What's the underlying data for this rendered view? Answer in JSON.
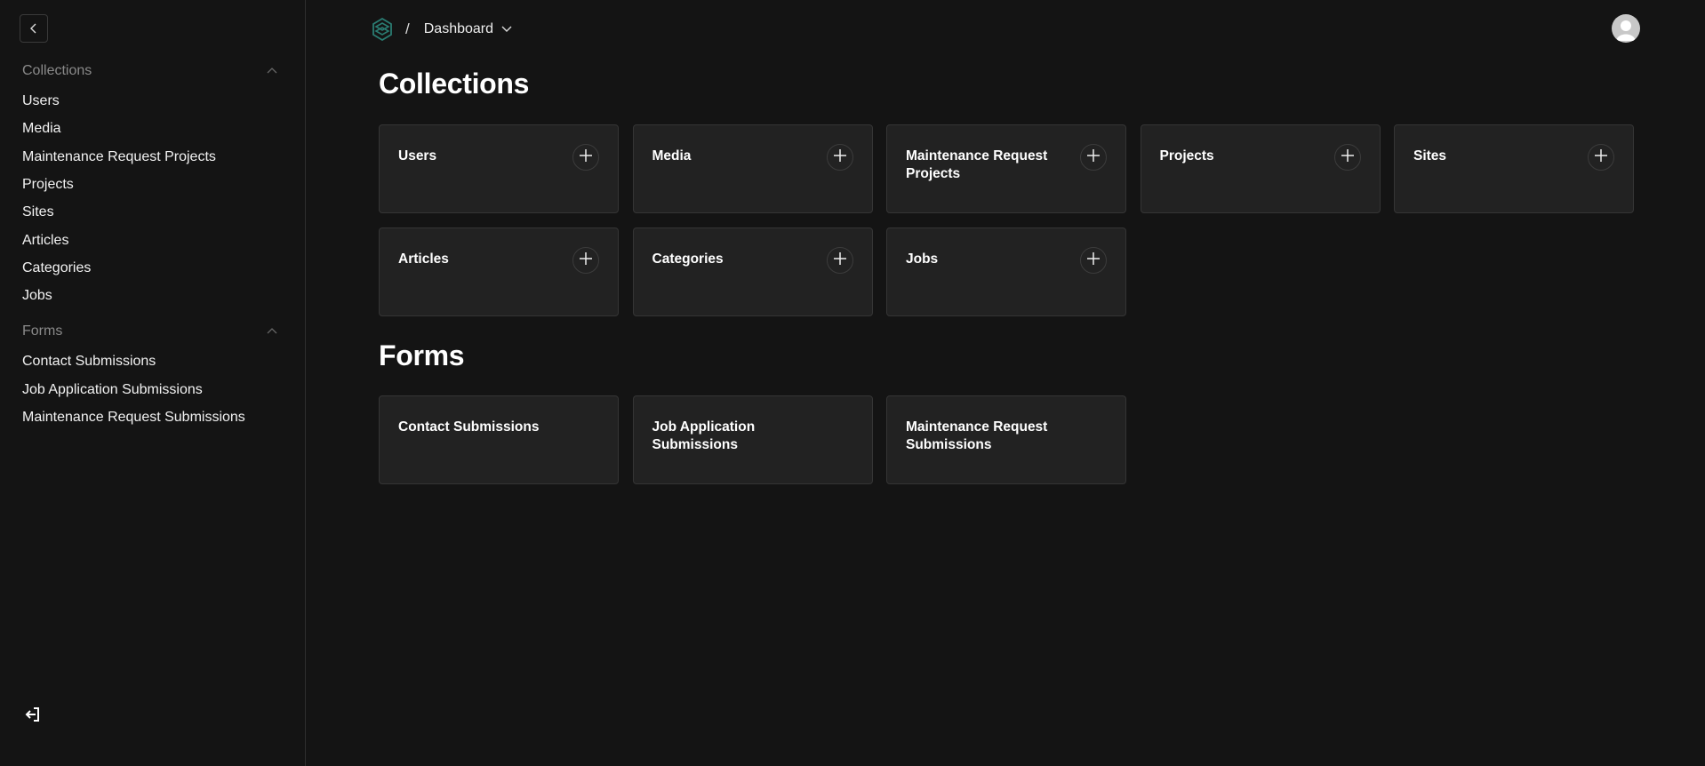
{
  "sidebar": {
    "groups": [
      {
        "label": "Collections",
        "items": [
          "Users",
          "Media",
          "Maintenance Request Projects",
          "Projects",
          "Sites",
          "Articles",
          "Categories",
          "Jobs"
        ]
      },
      {
        "label": "Forms",
        "items": [
          "Contact Submissions",
          "Job Application Submissions",
          "Maintenance Request Submissions"
        ]
      }
    ]
  },
  "header": {
    "separator": "/",
    "current": "Dashboard"
  },
  "main": {
    "collections_title": "Collections",
    "collections": [
      "Users",
      "Media",
      "Maintenance Request Projects",
      "Projects",
      "Sites",
      "Articles",
      "Categories",
      "Jobs"
    ],
    "forms_title": "Forms",
    "forms": [
      "Contact Submissions",
      "Job Application Submissions",
      "Maintenance Request Submissions"
    ]
  },
  "colors": {
    "background": "#141414",
    "card": "#222222",
    "logo": "#2a7c72"
  }
}
